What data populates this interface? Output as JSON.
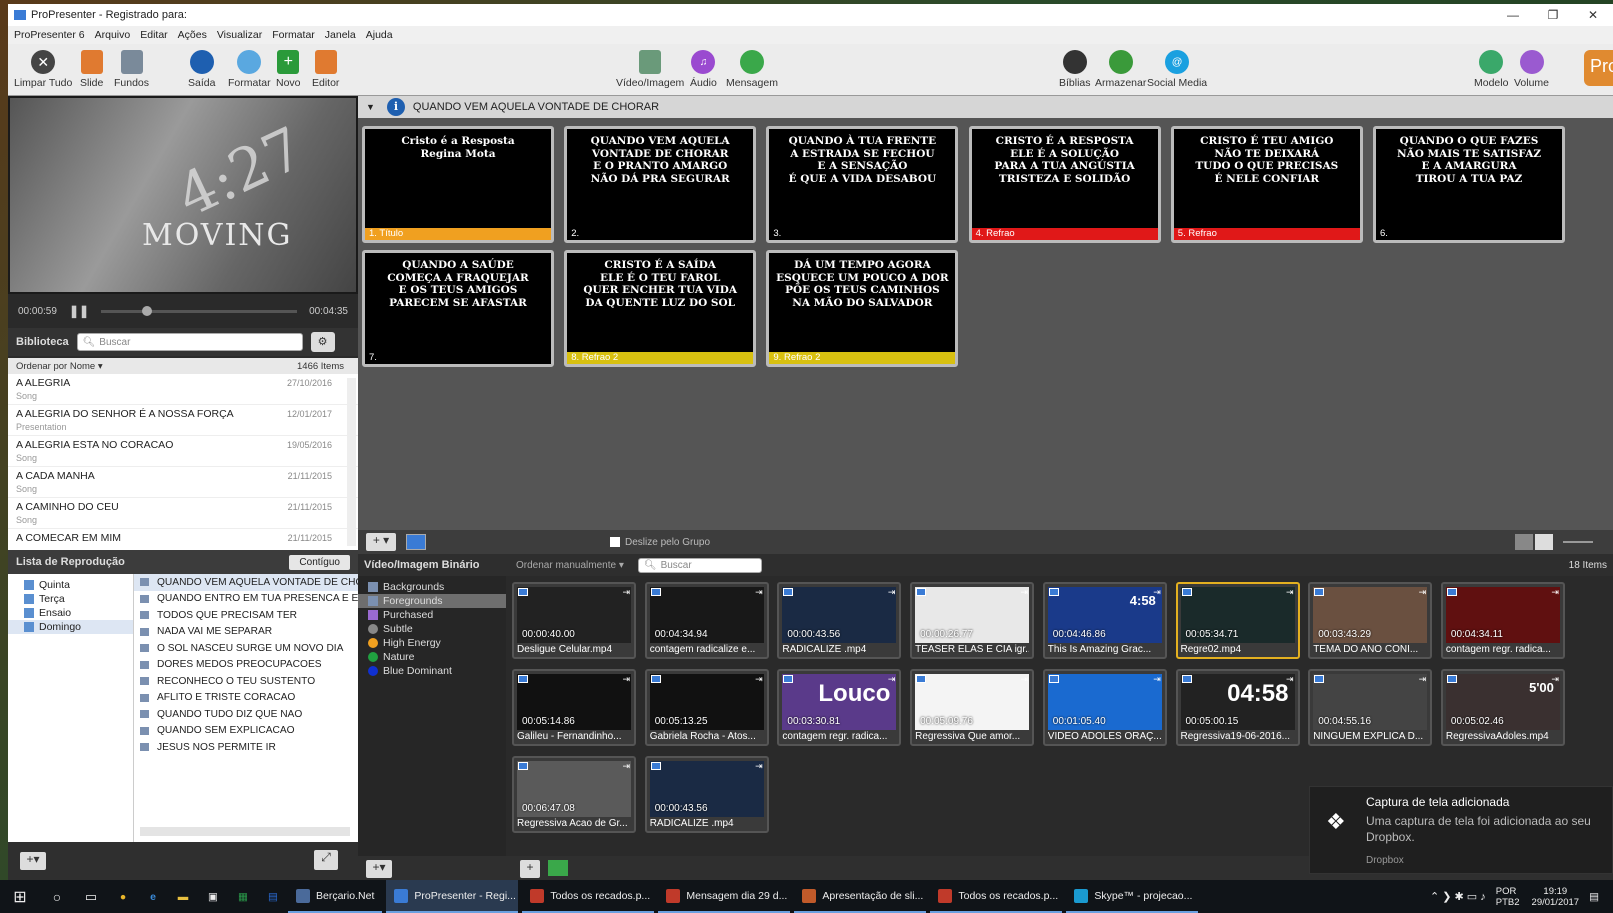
{
  "window": {
    "title": "ProPresenter - Registrado para:"
  },
  "menu": [
    "ProPresenter 6",
    "Arquivo",
    "Editar",
    "Ações",
    "Visualizar",
    "Formatar",
    "Janela",
    "Ajuda"
  ],
  "toolbar": {
    "clear_all": "Limpar Tudo",
    "slide": "Slide",
    "backgrounds": "Fundos",
    "output": "Saída",
    "format": "Formatar",
    "new": "Novo",
    "editor": "Editor",
    "video_image": "Vídeo/Imagem",
    "audio": "Áudio",
    "message": "Mensagem",
    "bibles": "Bíblias",
    "store": "Armazenar",
    "social": "Social Media",
    "template": "Modelo",
    "volume": "Volume",
    "logo": "Pro"
  },
  "preview": {
    "number": "4:27",
    "word": "MOVING",
    "time_elapsed": "00:00:59",
    "time_total": "00:04:35",
    "progress": 0.21
  },
  "library": {
    "title": "Biblioteca",
    "search_placeholder": "Buscar",
    "sort": "Ordenar por Nome ▾",
    "count": "1466 Items",
    "items": [
      {
        "name": "A ALEGRIA",
        "kind": "Song",
        "date": "27/10/2016"
      },
      {
        "name": "A ALEGRIA DO SENHOR É A NOSSA FORÇA",
        "kind": "Presentation",
        "date": "12/01/2017"
      },
      {
        "name": "A ALEGRIA ESTA NO CORACAO",
        "kind": "Song",
        "date": "19/05/2016"
      },
      {
        "name": "A CADA MANHA",
        "kind": "Song",
        "date": "21/11/2015"
      },
      {
        "name": "A CAMINHO DO CEU",
        "kind": "Song",
        "date": "21/11/2015"
      },
      {
        "name": "A COMECAR EM MIM",
        "kind": "",
        "date": "21/11/2015"
      }
    ]
  },
  "playlist": {
    "title": "Lista de Reprodução",
    "button": "Contíguo",
    "groups": [
      "Quinta",
      "Terça",
      "Ensaio",
      "Domingo"
    ],
    "items": [
      "QUANDO VEM AQUELA VONTADE DE CHO",
      "QUANDO ENTRO EM TUA PRESENCA E EX",
      "TODOS QUE PRECISAM TER",
      "NADA VAI ME SEPARAR",
      "O SOL NASCEU SURGE UM NOVO DIA",
      "DORES MEDOS PREOCUPACOES",
      "RECONHECO O TEU SUSTENTO",
      "AFLITO E TRISTE CORACAO",
      "QUANDO TUDO DIZ QUE NAO",
      "QUANDO SEM EXPLICACAO",
      "JESUS NOS PERMITE IR"
    ]
  },
  "presentation": {
    "title": "QUANDO VEM AQUELA VONTADE DE CHORAR",
    "group_slide_label": "Deslize pelo Grupo",
    "slides": [
      {
        "text": "Cristo é a Resposta\nRegina Mota",
        "label": "1. Título",
        "color": "#f0a020"
      },
      {
        "text": "QUANDO VEM AQUELA\nVONTADE DE CHORAR\nE O PRANTO AMARGO\nNÃO DÁ PRA SEGURAR",
        "label": "2.",
        "color": ""
      },
      {
        "text": "QUANDO À TUA FRENTE\nA ESTRADA SE FECHOU\nE A SENSAÇÃO\nÉ QUE A VIDA DESABOU",
        "label": "3.",
        "color": ""
      },
      {
        "text": "CRISTO É A RESPOSTA\nELE É A SOLUÇÃO\nPARA A TUA ANGÚSTIA\nTRISTEZA E SOLIDÃO",
        "label": "4. Refrao",
        "color": "#e01818"
      },
      {
        "text": "CRISTO É TEU AMIGO\nNÃO TE DEIXARÁ\nTUDO O QUE PRECISAS\nÉ NELE CONFIAR",
        "label": "5. Refrao",
        "color": "#e01818"
      },
      {
        "text": "QUANDO O QUE FAZES\nNÃO MAIS TE SATISFAZ\nE A AMARGURA\nTIROU A TUA PAZ",
        "label": "6.",
        "color": ""
      },
      {
        "text": "QUANDO A SAÚDE\nCOMEÇA A FRAQUEJAR\nE OS TEUS AMIGOS\nPARECEM SE AFASTAR",
        "label": "7.",
        "color": ""
      },
      {
        "text": "CRISTO É A SAÍDA\nELE É O TEU FAROL\nQUER ENCHER TUA VIDA\nDA QUENTE LUZ DO SOL",
        "label": "8. Refrao 2",
        "color": "#d8c010"
      },
      {
        "text": "DÁ UM TEMPO AGORA\nESQUECE UM POUCO A DOR\nPÕE OS TEUS CAMINHOS\nNA MÃO DO SALVADOR",
        "label": "9. Refrao 2",
        "color": "#d8c010"
      }
    ]
  },
  "media": {
    "title": "Vídeo/Imagem Binário",
    "sort": "Ordenar manualmente ▾",
    "search_placeholder": "Buscar",
    "count": "18 Items",
    "categories": [
      {
        "name": "Backgrounds",
        "color": "#7b90b0"
      },
      {
        "name": "Foregrounds",
        "color": "#7b90b0"
      },
      {
        "name": "Purchased",
        "color": "#9a6ad0"
      },
      {
        "name": "Subtle",
        "color": "#888888"
      },
      {
        "name": "High Energy",
        "color": "#f0a020"
      },
      {
        "name": "Nature",
        "color": "#20a040"
      },
      {
        "name": "Blue Dominant",
        "color": "#1030d0"
      }
    ],
    "items": [
      {
        "time": "00:00:40.00",
        "name": "Desligue Celular.mp4",
        "bg": "#222",
        "overlay": ""
      },
      {
        "time": "00:04:34.94",
        "name": "contagem radicalize e...",
        "bg": "#181818",
        "overlay": ""
      },
      {
        "time": "00:00:43.56",
        "name": "RADICALIZE .mp4",
        "bg": "#1a2a44",
        "overlay": ""
      },
      {
        "time": "00:00:26.77",
        "name": "TEASER ELAS E CIA igr...",
        "bg": "#e8e8e8",
        "overlay": ""
      },
      {
        "time": "00:04:46.86",
        "name": "This Is Amazing Grac...",
        "bg": "#1a3a8a",
        "overlay": "4:58"
      },
      {
        "time": "00:05:34.71",
        "name": "Regre02.mp4",
        "bg": "#1a2a2a",
        "overlay": ""
      },
      {
        "time": "00:03:43.29",
        "name": "TEMA DO ANO CONI...",
        "bg": "#6a5040",
        "overlay": ""
      },
      {
        "time": "00:04:34.11",
        "name": "contagem regr. radica...",
        "bg": "#601010",
        "overlay": ""
      },
      {
        "time": "00:05:14.86",
        "name": "Galileu - Fernandinho...",
        "bg": "#111",
        "overlay": ""
      },
      {
        "time": "00:05:13.25",
        "name": "Gabriela Rocha - Atos...",
        "bg": "#111",
        "overlay": ""
      },
      {
        "time": "00:03:30.81",
        "name": "contagem regr. radica...",
        "bg": "#5a3a8a",
        "overlay": "Louco"
      },
      {
        "time": "00:05:09.76",
        "name": "Regressiva Que amor...",
        "bg": "#f4f4f4",
        "overlay": ""
      },
      {
        "time": "00:01:05.40",
        "name": "VIDEO ADOLES ORAÇ...",
        "bg": "#1a6ad0",
        "overlay": ""
      },
      {
        "time": "00:05:00.15",
        "name": "Regressiva19-06-2016...",
        "bg": "#222",
        "overlay": "04:58"
      },
      {
        "time": "00:04:55.16",
        "name": "NINGUEM EXPLICA D...",
        "bg": "#444",
        "overlay": ""
      },
      {
        "time": "00:05:02.46",
        "name": "RegressivaAdoles.mp4",
        "bg": "#3a3030",
        "overlay": "5'00"
      },
      {
        "time": "00:06:47.08",
        "name": "Regressiva Acao de Gr...",
        "bg": "#5a5a5a",
        "overlay": ""
      },
      {
        "time": "00:00:43.56",
        "name": "RADICALIZE .mp4",
        "bg": "#1a2a44",
        "overlay": ""
      }
    ]
  },
  "toast": {
    "title": "Captura de tela adicionada",
    "body": "Uma captura de tela foi adicionada ao seu Dropbox.",
    "source": "Dropbox"
  },
  "taskbar": {
    "items": [
      "Berçario.Net",
      "ProPresenter - Regi...",
      "Todos os recados.p...",
      "Mensagem dia 29 d...",
      "Apresentação de sli...",
      "Todos os recados.p...",
      "Skype™ - projecao..."
    ],
    "lang": "POR",
    "lang2": "PTB2",
    "time": "19:19",
    "date": "29/01/2017"
  },
  "colors": {
    "accent": "#3a7bd5",
    "selected_media": "#e3b020"
  }
}
